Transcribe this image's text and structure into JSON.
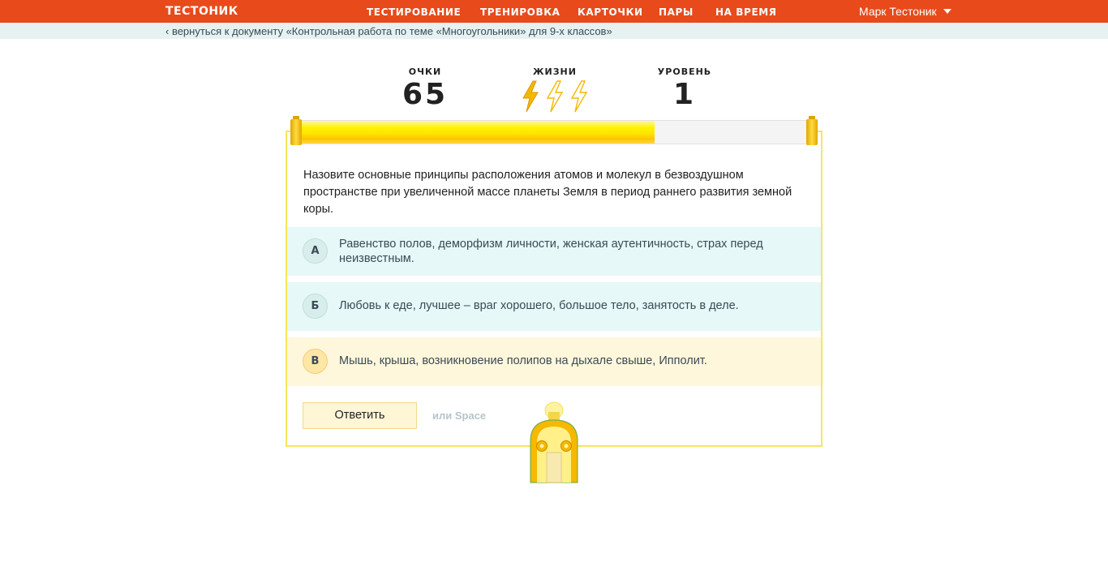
{
  "header": {
    "logo": "ТЕСТОНИК",
    "nav": [
      {
        "label": "ТЕСТИРОВАНИЕ"
      },
      {
        "label": "ТРЕНИРОВКА"
      },
      {
        "label": "КАРТОЧКИ"
      },
      {
        "label": "ПАРЫ"
      },
      {
        "label": "НА ВРЕМЯ"
      }
    ],
    "user": "Марк Тестоник",
    "user_icon": "chevron-down-icon"
  },
  "subbar": {
    "back_link": "‹ вернуться к документу «Контрольная работа по теме «Многоугольники» для 9-х классов»"
  },
  "stats": {
    "score_label": "ОЧКИ",
    "score_value": "65",
    "lives_label": "ЖИЗНИ",
    "lives_total": 3,
    "lives_remaining": 1,
    "level_label": "УРОВЕНЬ",
    "level_value": "1"
  },
  "progress": {
    "fraction": 0.69
  },
  "quiz": {
    "question": "Назовите основные принципы расположения атомов и молекул в безвоздушном пространстве при увеличенной массе планеты Земля в период раннего развития земной коры.",
    "answers": [
      {
        "letter": "А",
        "text": "Равенство полов, деморфизм личности, женская аутентичность, страх перед неизвестным."
      },
      {
        "letter": "Б",
        "text": "Любовь к еде, лучшее – враг хорошего, большое тело, занятость в деле."
      },
      {
        "letter": "В",
        "text": "Мышь, крыша, возникновение полипов на дыхале свыше, Ипполит."
      }
    ],
    "submit_label": "Ответить",
    "hint": "или Space"
  },
  "colors": {
    "header_bg": "#e84a1b",
    "subbar_bg": "#e6f2f1",
    "answer_bg": "#e6f8f7",
    "selected_answer_bg": "#fff7dc",
    "accent_yellow": "#ffe500",
    "bolt_active": "#f5b800"
  }
}
